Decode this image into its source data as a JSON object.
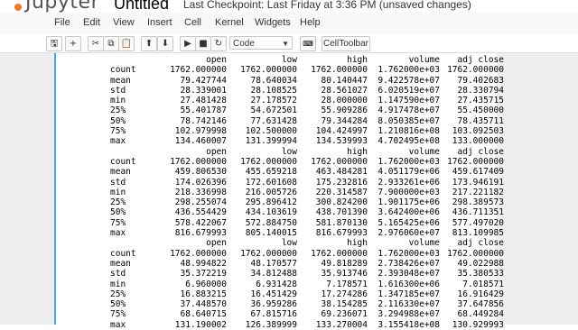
{
  "app": {
    "logo": "Jupyter",
    "notebook_title": "Untitled",
    "checkpoint": "Last Checkpoint: Last Friday at 3:36 PM (unsaved changes)"
  },
  "menu": [
    "File",
    "Edit",
    "View",
    "Insert",
    "Cell",
    "Kernel",
    "Widgets",
    "Help"
  ],
  "toolbar": {
    "buttons": [
      {
        "name": "save-icon",
        "glyph": "🖫"
      },
      {
        "name": "add-cell-icon",
        "glyph": "+"
      },
      {
        "name": "cut-icon",
        "glyph": "✂"
      },
      {
        "name": "copy-icon",
        "glyph": "⧉"
      },
      {
        "name": "paste-icon",
        "glyph": "📋"
      },
      {
        "name": "move-up-icon",
        "glyph": "⬆"
      },
      {
        "name": "move-down-icon",
        "glyph": "⬇"
      },
      {
        "name": "run-icon",
        "glyph": "▶"
      },
      {
        "name": "stop-icon",
        "glyph": "■"
      },
      {
        "name": "restart-icon",
        "glyph": "↻"
      }
    ],
    "cell_type": "Code",
    "celltoolbar_label": "CellToolbar",
    "keyboard_icon": "keyboard-icon"
  },
  "output": {
    "columns": [
      "open",
      "low",
      "high",
      "volume",
      "adj close"
    ],
    "blocks": [
      [
        [
          "count",
          "1762.000000",
          "1762.000000",
          "1762.000000",
          "1.762000e+03",
          "1762.000000"
        ],
        [
          "mean",
          "79.427744",
          "78.640034",
          "80.140447",
          "9.422578e+07",
          "79.402683"
        ],
        [
          "std",
          "28.339001",
          "28.108525",
          "28.561027",
          "6.020519e+07",
          "28.330794"
        ],
        [
          "min",
          "27.481428",
          "27.178572",
          "28.000000",
          "1.147590e+07",
          "27.435715"
        ],
        [
          "25%",
          "55.401787",
          "54.672501",
          "55.909286",
          "4.917478e+07",
          "55.450000"
        ],
        [
          "50%",
          "78.742146",
          "77.631428",
          "79.344284",
          "8.050385e+07",
          "78.435711"
        ],
        [
          "75%",
          "102.979998",
          "102.500000",
          "104.424997",
          "1.210816e+08",
          "103.092503"
        ],
        [
          "max",
          "134.460007",
          "131.399994",
          "134.539993",
          "4.702495e+08",
          "133.000000"
        ]
      ],
      [
        [
          "count",
          "1762.000000",
          "1762.000000",
          "1762.000000",
          "1.762000e+03",
          "1762.000000"
        ],
        [
          "mean",
          "459.806530",
          "455.659218",
          "463.484281",
          "4.051179e+06",
          "459.617409"
        ],
        [
          "std",
          "174.026396",
          "172.601608",
          "175.232816",
          "2.933261e+06",
          "173.946191"
        ],
        [
          "min",
          "218.336998",
          "216.005726",
          "220.314587",
          "7.900000e+03",
          "217.221182"
        ],
        [
          "25%",
          "298.255074",
          "295.896412",
          "300.824200",
          "1.901175e+06",
          "298.389573"
        ],
        [
          "50%",
          "436.554429",
          "434.103619",
          "438.701390",
          "3.642400e+06",
          "436.711351"
        ],
        [
          "75%",
          "578.422067",
          "572.884750",
          "581.870130",
          "5.165425e+06",
          "577.497020"
        ],
        [
          "max",
          "816.679993",
          "805.140015",
          "816.679993",
          "2.976060e+07",
          "813.109985"
        ]
      ],
      [
        [
          "count",
          "1762.000000",
          "1762.000000",
          "1762.000000",
          "1.762000e+03",
          "1762.000000"
        ],
        [
          "mean",
          "48.994822",
          "48.170577",
          "49.818289",
          "2.738426e+07",
          "49.022988"
        ],
        [
          "std",
          "35.372219",
          "34.812488",
          "35.913746",
          "2.393048e+07",
          "35.380533"
        ],
        [
          "min",
          "6.960000",
          "6.931428",
          "7.178571",
          "1.616300e+06",
          "7.018571"
        ],
        [
          "25%",
          "16.883215",
          "16.451429",
          "17.274286",
          "1.347185e+07",
          "16.916429"
        ],
        [
          "50%",
          "37.448570",
          "36.959286",
          "38.154285",
          "2.116330e+07",
          "37.647856"
        ],
        [
          "75%",
          "68.640715",
          "67.815716",
          "69.236071",
          "3.294988e+07",
          "68.449284"
        ],
        [
          "max",
          "131.190002",
          "126.389999",
          "133.270004",
          "3.155418e+08",
          "130.929993"
        ]
      ]
    ]
  }
}
